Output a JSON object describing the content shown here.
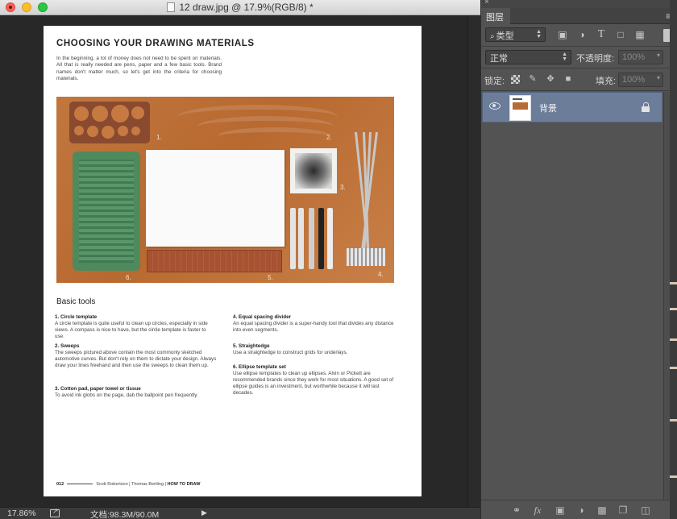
{
  "window": {
    "title": "12 draw.jpg @ 17.9%(RGB/8) *"
  },
  "document": {
    "heading": "CHOOSING YOUR DRAWING MATERIALS",
    "intro": "In the beginning, a lot of money does not need to be spent on materials. All that is really needed are pens, paper and a few basic tools. Brand names don't matter much, so let's get into the criteria for choosing materials.",
    "photo_labels": [
      "1.",
      "2.",
      "3.",
      "4.",
      "5.",
      "6."
    ],
    "section_title": "Basic tools",
    "tools": [
      {
        "title": "1. Circle template",
        "text": "A circle template is quite useful to clean up circles, especially in side views. A compass is nice to have, but the circle template is faster to use."
      },
      {
        "title": "2. Sweeps",
        "text": "The sweeps pictured above contain the most commonly sketched automotive curves. But don't rely on them to dictate your design. Always draw your lines freehand and then use the sweeps to clean them up."
      },
      {
        "title": "3. Cotton pad, paper towel or tissue",
        "text": "To avoid ink globs on the page, dab the ballpoint pen frequently."
      },
      {
        "title": "4. Equal spacing divider",
        "text": "An equal spacing divider is a super-handy tool that divides any distance into even segments."
      },
      {
        "title": "5. Straightedge",
        "text": "Use a straightedge to construct grids for underlays."
      },
      {
        "title": "6. Ellipse template set",
        "text": "Use ellipse templates to clean up ellipses. Alvin or Pickett are recommended brands since they work for most situations. A good set of ellipse guides is an investment, but worthwhile because it will last decades."
      }
    ],
    "footer": {
      "page_number": "012",
      "authors": "Scott Robertson | Thomas Bertling |",
      "book": "HOW TO DRAW"
    }
  },
  "status_bar": {
    "zoom": "17.86%",
    "doc_size": "文档:98.3M/90.0M",
    "arrow": "▶"
  },
  "layers_panel": {
    "tab_label": "图层",
    "menu_icon": "≡",
    "close_icon": "×",
    "collapse_icon": "»",
    "filter_search": "⌕",
    "filter_label": "类型",
    "filter_icons": [
      "image-filter-icon",
      "adjustment-filter-icon",
      "type-filter-icon",
      "shape-filter-icon",
      "smart-object-filter-icon"
    ],
    "blend_mode": "正常",
    "opacity_label": "不透明度:",
    "opacity_value": "100%",
    "lock_label": "锁定:",
    "fill_label": "填充:",
    "fill_value": "100%",
    "layers": [
      {
        "name": "背景",
        "visible": true,
        "locked": true
      }
    ],
    "bottom_icons": [
      "link-icon",
      "fx-icon",
      "mask-icon",
      "adjustment-icon",
      "folder-icon",
      "new-layer-icon",
      "trash-icon"
    ],
    "fx_text": "fx"
  },
  "colors": {
    "selected_layer": "#6c7d99",
    "panel_bg": "#535353",
    "canvas_bg": "#282828"
  }
}
